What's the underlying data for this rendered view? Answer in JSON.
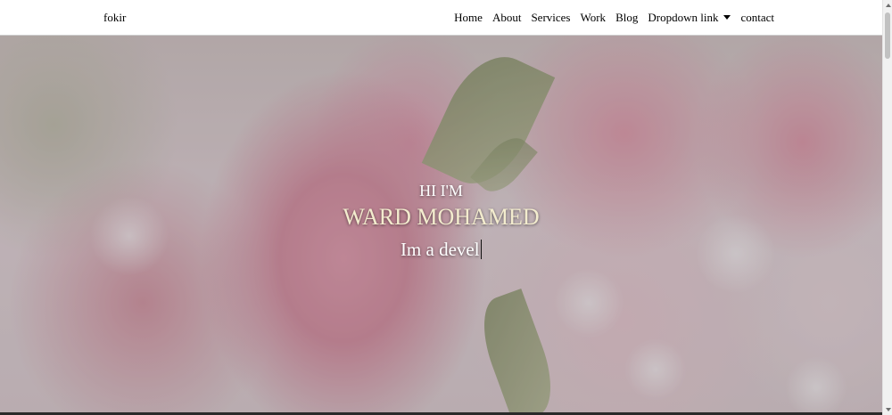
{
  "navbar": {
    "brand": "fokir",
    "items": [
      {
        "label": "Home"
      },
      {
        "label": "About"
      },
      {
        "label": "Services"
      },
      {
        "label": "Work"
      },
      {
        "label": "Blog"
      },
      {
        "label": "Dropdown link",
        "icon": "caret-down-icon"
      },
      {
        "label": "contact"
      }
    ]
  },
  "hero": {
    "greeting": "HI I'M",
    "name": "WARD MOHAMED",
    "typed_text": "Im a devel"
  },
  "colors": {
    "navbar_bg": "#ffffff",
    "name_text": "#f3ecce",
    "hero_text": "#ffffff"
  }
}
